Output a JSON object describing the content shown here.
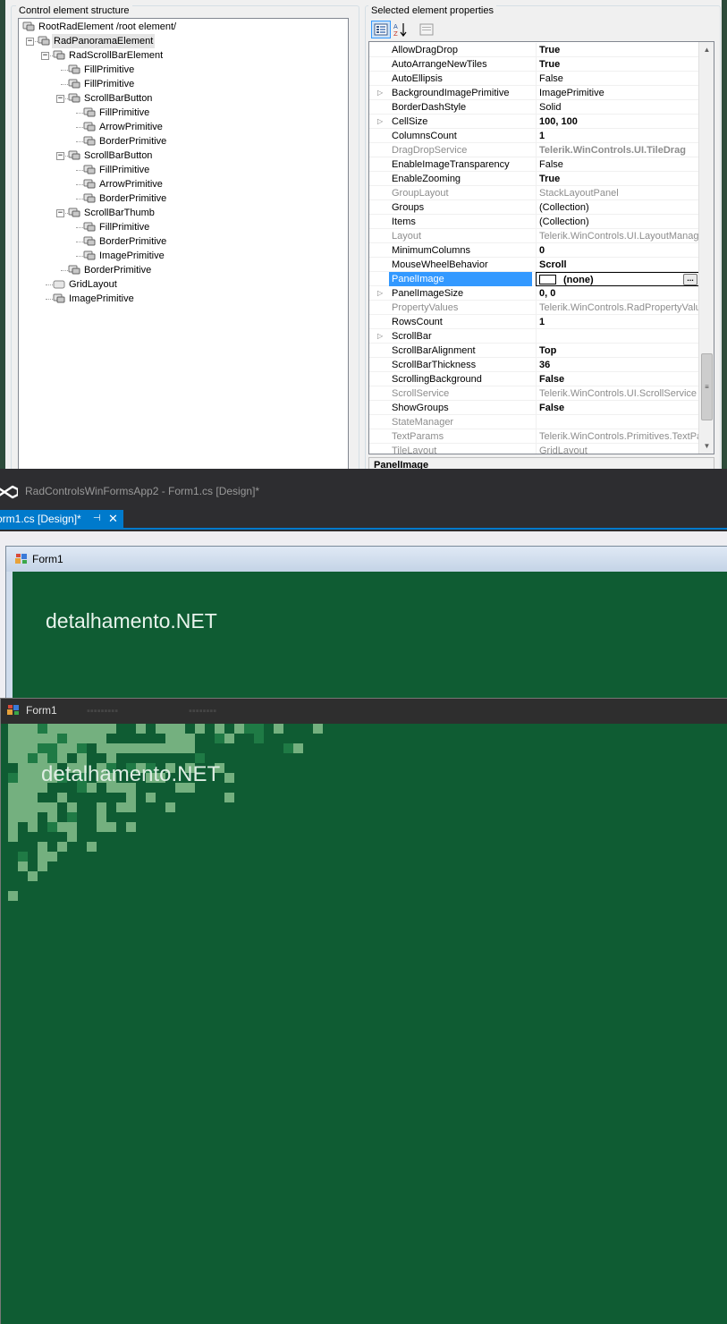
{
  "editor": {
    "tree_group_title": "Control element structure",
    "props_group_title": "Selected element properties",
    "tree": [
      {
        "label": "RootRadElement /root element/",
        "level": 0,
        "expander": "",
        "selected": false
      },
      {
        "label": "RadPanoramaElement",
        "level": 1,
        "expander": "−",
        "selected": true
      },
      {
        "label": "RadScrollBarElement",
        "level": 2,
        "expander": "−",
        "selected": false
      },
      {
        "label": "FillPrimitive",
        "level": 3,
        "expander": "",
        "selected": false
      },
      {
        "label": "FillPrimitive",
        "level": 3,
        "expander": "",
        "selected": false
      },
      {
        "label": "ScrollBarButton",
        "level": 3,
        "expander": "−",
        "selected": false
      },
      {
        "label": "FillPrimitive",
        "level": 4,
        "expander": "",
        "selected": false
      },
      {
        "label": "ArrowPrimitive",
        "level": 4,
        "expander": "",
        "selected": false
      },
      {
        "label": "BorderPrimitive",
        "level": 4,
        "expander": "",
        "selected": false
      },
      {
        "label": "ScrollBarButton",
        "level": 3,
        "expander": "−",
        "selected": false
      },
      {
        "label": "FillPrimitive",
        "level": 4,
        "expander": "",
        "selected": false
      },
      {
        "label": "ArrowPrimitive",
        "level": 4,
        "expander": "",
        "selected": false
      },
      {
        "label": "BorderPrimitive",
        "level": 4,
        "expander": "",
        "selected": false
      },
      {
        "label": "ScrollBarThumb",
        "level": 3,
        "expander": "−",
        "selected": false
      },
      {
        "label": "FillPrimitive",
        "level": 4,
        "expander": "",
        "selected": false
      },
      {
        "label": "BorderPrimitive",
        "level": 4,
        "expander": "",
        "selected": false
      },
      {
        "label": "ImagePrimitive",
        "level": 4,
        "expander": "",
        "selected": false
      },
      {
        "label": "BorderPrimitive",
        "level": 3,
        "expander": "",
        "selected": false
      },
      {
        "label": "GridLayout",
        "level": 2,
        "expander": "",
        "selected": false,
        "icon": "layout"
      },
      {
        "label": "ImagePrimitive",
        "level": 2,
        "expander": "",
        "selected": false
      }
    ],
    "properties": [
      {
        "name": "AllowDragDrop",
        "value": "True",
        "bold": true,
        "readonly": false,
        "expandable": false
      },
      {
        "name": "AutoArrangeNewTiles",
        "value": "True",
        "bold": true,
        "readonly": false,
        "expandable": false
      },
      {
        "name": "AutoEllipsis",
        "value": "False",
        "bold": false,
        "readonly": false,
        "expandable": false
      },
      {
        "name": "BackgroundImagePrimitive",
        "value": "ImagePrimitive",
        "bold": false,
        "readonly": false,
        "expandable": true
      },
      {
        "name": "BorderDashStyle",
        "value": "Solid",
        "bold": false,
        "readonly": false,
        "expandable": false
      },
      {
        "name": "CellSize",
        "value": "100, 100",
        "bold": true,
        "readonly": false,
        "expandable": true
      },
      {
        "name": "ColumnsCount",
        "value": "1",
        "bold": true,
        "readonly": false,
        "expandable": false
      },
      {
        "name": "DragDropService",
        "value": "Telerik.WinControls.UI.TileDrag",
        "bold": true,
        "readonly": true,
        "expandable": false
      },
      {
        "name": "EnableImageTransparency",
        "value": "False",
        "bold": false,
        "readonly": false,
        "expandable": false
      },
      {
        "name": "EnableZooming",
        "value": "True",
        "bold": true,
        "readonly": false,
        "expandable": false
      },
      {
        "name": "GroupLayout",
        "value": "StackLayoutPanel",
        "bold": false,
        "readonly": true,
        "expandable": false
      },
      {
        "name": "Groups",
        "value": "(Collection)",
        "bold": false,
        "readonly": false,
        "expandable": false
      },
      {
        "name": "Items",
        "value": "(Collection)",
        "bold": false,
        "readonly": false,
        "expandable": false
      },
      {
        "name": "Layout",
        "value": "Telerik.WinControls.UI.LayoutManage",
        "bold": false,
        "readonly": true,
        "expandable": false
      },
      {
        "name": "MinimumColumns",
        "value": "0",
        "bold": true,
        "readonly": false,
        "expandable": false
      },
      {
        "name": "MouseWheelBehavior",
        "value": "Scroll",
        "bold": true,
        "readonly": false,
        "expandable": false
      },
      {
        "name": "PanelImage",
        "value": "(none)",
        "bold": true,
        "readonly": false,
        "expandable": false,
        "selected": true
      },
      {
        "name": "PanelImageSize",
        "value": "0, 0",
        "bold": true,
        "readonly": false,
        "expandable": true
      },
      {
        "name": "PropertyValues",
        "value": "Telerik.WinControls.RadPropertyValue",
        "bold": false,
        "readonly": true,
        "expandable": false
      },
      {
        "name": "RowsCount",
        "value": "1",
        "bold": true,
        "readonly": false,
        "expandable": false
      },
      {
        "name": "ScrollBar",
        "value": "",
        "bold": false,
        "readonly": false,
        "expandable": true
      },
      {
        "name": "ScrollBarAlignment",
        "value": "Top",
        "bold": true,
        "readonly": false,
        "expandable": false
      },
      {
        "name": "ScrollBarThickness",
        "value": "36",
        "bold": true,
        "readonly": false,
        "expandable": false
      },
      {
        "name": "ScrollingBackground",
        "value": "False",
        "bold": true,
        "readonly": false,
        "expandable": false
      },
      {
        "name": "ScrollService",
        "value": "Telerik.WinControls.UI.ScrollService",
        "bold": false,
        "readonly": true,
        "expandable": false
      },
      {
        "name": "ShowGroups",
        "value": "False",
        "bold": true,
        "readonly": false,
        "expandable": false
      },
      {
        "name": "StateManager",
        "value": "",
        "bold": false,
        "readonly": true,
        "expandable": false
      },
      {
        "name": "TextParams",
        "value": "Telerik.WinControls.Primitives.TextPara",
        "bold": false,
        "readonly": true,
        "expandable": false
      },
      {
        "name": "TileLayout",
        "value": "GridLayout",
        "bold": false,
        "readonly": true,
        "expandable": false
      }
    ],
    "description_title": "PanelImage",
    "toolbar": {
      "categorized_icon": "categorized-icon",
      "alphabetical_icon": "sort-az-icon",
      "property_pages_icon": "property-pages-icon"
    }
  },
  "vs": {
    "window_title": "RadControlsWinFormsApp2 - Form1.cs [Design]*",
    "tab_label": "orm1.cs [Design]*",
    "tab_pin": "⊣",
    "tab_close": "✕"
  },
  "form_a": {
    "title": "Form1",
    "brand": "detalhamento.NET"
  },
  "form_b": {
    "title": "Form1",
    "brand": "detalhamento.NET"
  },
  "colors": {
    "tile_green": "#0f5c33",
    "tile_light": "#74b07f",
    "tile_mid": "#1f7a45",
    "accent": "#007acc"
  }
}
